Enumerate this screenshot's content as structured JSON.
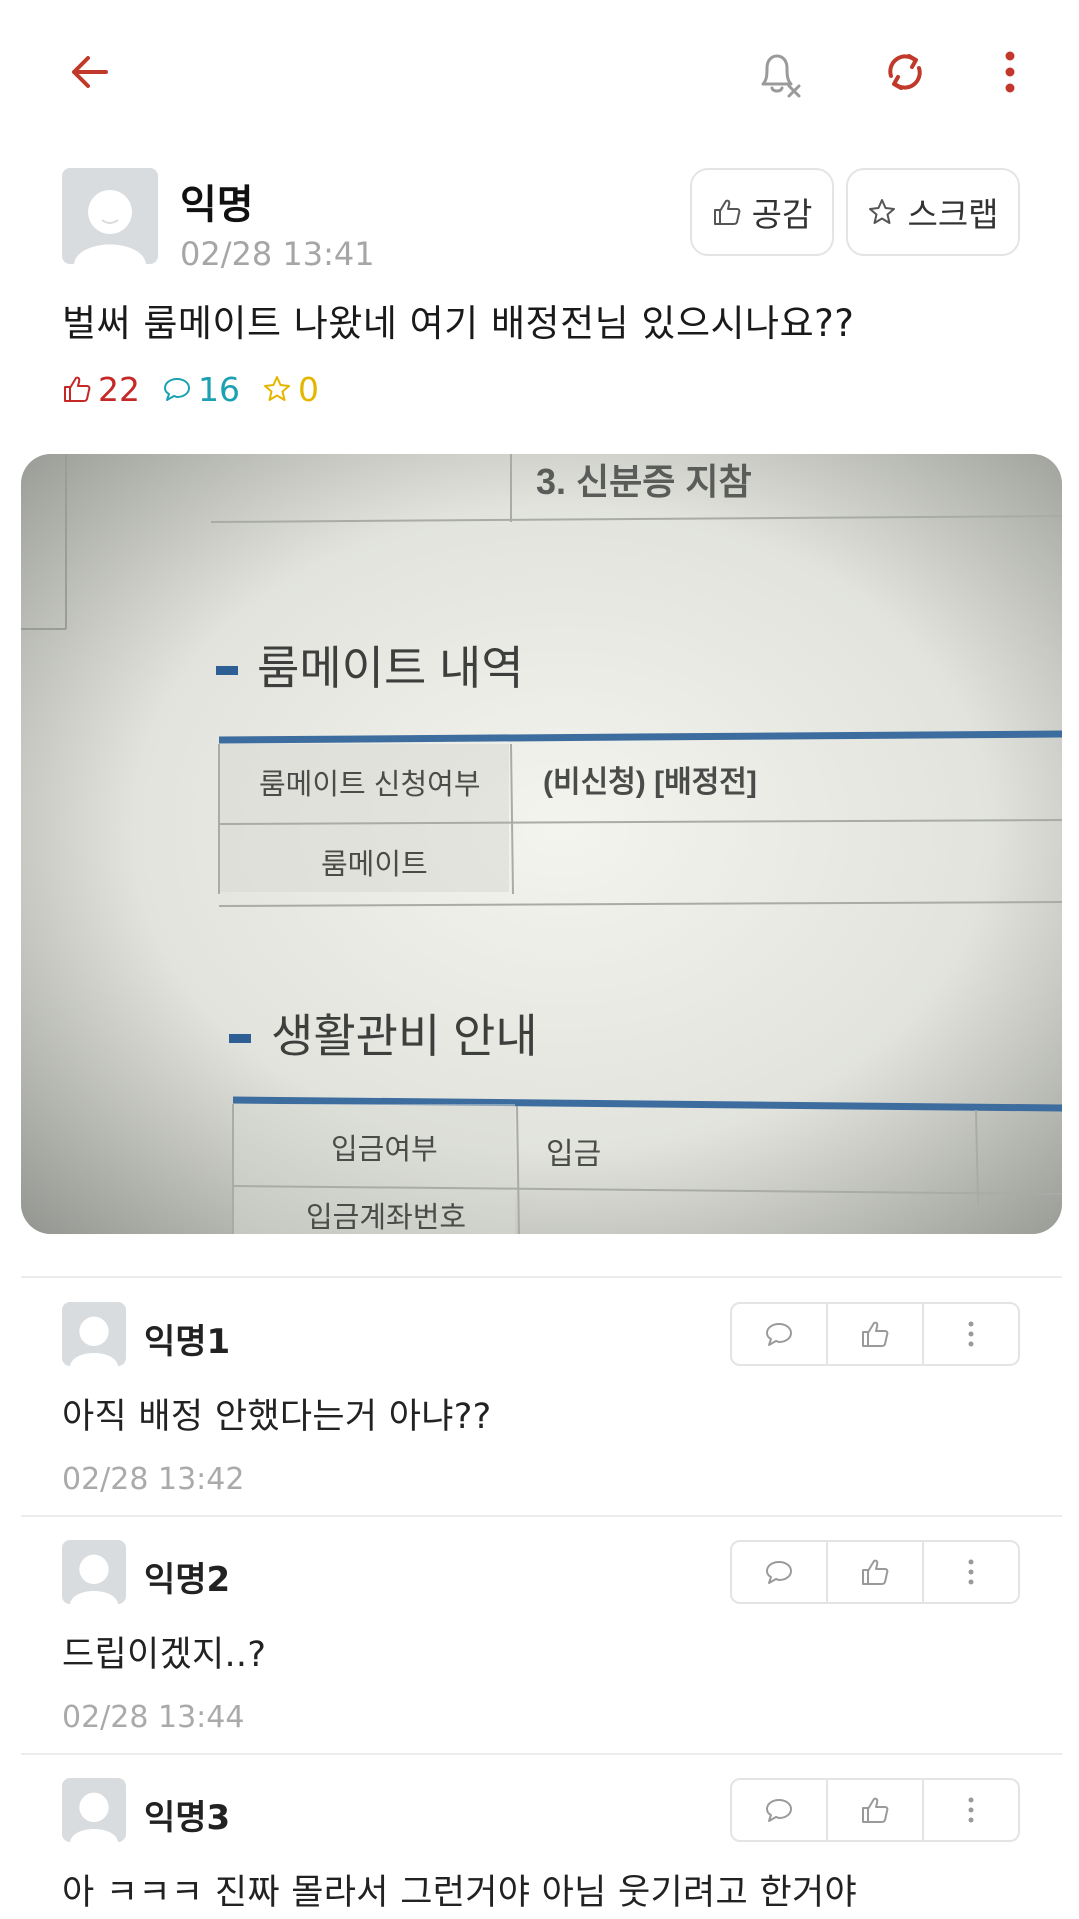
{
  "header": {
    "back_icon": "arrow-left-icon",
    "notification_icon": "bell-off-icon",
    "refresh_icon": "refresh-icon",
    "more_icon": "more-vertical-icon",
    "accent_color": "#c0392b"
  },
  "post": {
    "author": "익명",
    "time": "02/28 13:41",
    "like_button_label": "공감",
    "scrap_button_label": "스크랩",
    "body": "벌써 룸메이트 나왔네 여기 배정전님 있으시나요??",
    "stats": {
      "likes": "22",
      "comments": "16",
      "scraps": "0"
    },
    "image": {
      "line_id_card": "3. 신분증 지참",
      "section_roommate": "룸메이트 내역",
      "row1_label": "룸메이트 신청여부",
      "row1_value": "(비신청) [배정전]",
      "row2_label": "룸메이트",
      "section_fee": "생활관비 안내",
      "row3_label": "입금여부",
      "row3_value": "입금",
      "row4_label": "입금계좌번호"
    }
  },
  "comments": [
    {
      "author": "익명1",
      "body": "아직 배정 안했다는거 아냐??",
      "time": "02/28 13:42"
    },
    {
      "author": "익명2",
      "body": "드립이겠지..?",
      "time": "02/28 13:44"
    },
    {
      "author": "익명3",
      "body": "아 ㅋㅋㅋ 진짜 몰라서 그런거야 아님 웃기려고 한거야",
      "time": ""
    }
  ]
}
